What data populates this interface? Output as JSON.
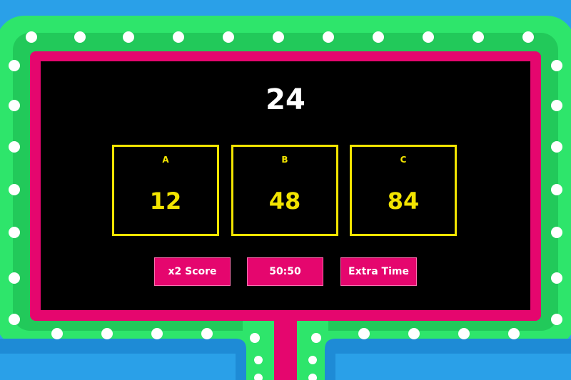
{
  "question": {
    "text": "24"
  },
  "options": [
    {
      "letter": "A",
      "value": "12"
    },
    {
      "letter": "B",
      "value": "48"
    },
    {
      "letter": "C",
      "value": "84"
    }
  ],
  "lifelines": [
    {
      "label": "x2 Score"
    },
    {
      "label": "50:50"
    },
    {
      "label": "Extra Time"
    }
  ],
  "colors": {
    "board": "#000000",
    "option_border": "#f2e400",
    "option_text": "#f2e400",
    "lifeline_bg": "#e5066e",
    "frame_pink": "#e5066e",
    "frame_green": "#2ee56b",
    "frame_blue": "#1e8bd6",
    "bulb": "#ffffff"
  }
}
